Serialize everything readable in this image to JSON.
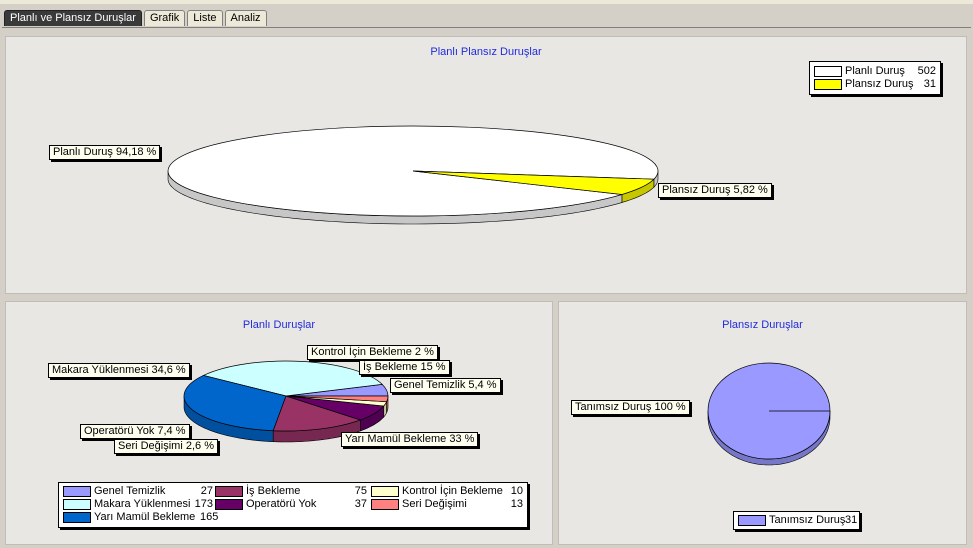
{
  "tabs": [
    {
      "label": "Planlı ve Plansız Duruşlar",
      "active": true
    },
    {
      "label": "Grafik",
      "active": false
    },
    {
      "label": "Liste",
      "active": false
    },
    {
      "label": "Analiz",
      "active": false
    }
  ],
  "chart_data": [
    {
      "type": "pie",
      "title": "Planlı Plansız Duruşlar",
      "slices": [
        {
          "name": "Planlı Duruş",
          "value": 502,
          "label": "Planlı Duruş 94,18 %",
          "color": "#ffffff"
        },
        {
          "name": "Plansız Duruş",
          "value": 31,
          "label": "Plansız Duruş 5,82 %",
          "color": "#ffff00"
        }
      ]
    },
    {
      "type": "pie",
      "title": "Planlı Duruşlar",
      "slices": [
        {
          "name": "Genel Temizlik",
          "value": 27,
          "label": "Genel Temizlik 5,4 %",
          "color": "#9999ff"
        },
        {
          "name": "Makara Yüklenmesi",
          "value": 173,
          "label": "Makara Yüklenmesi 34,6 %",
          "color": "#ccffff"
        },
        {
          "name": "Yarı Mamül Bekleme",
          "value": 165,
          "label": "Yarı Mamül Bekleme 33 %",
          "color": "#0066cc"
        },
        {
          "name": "İş Bekleme",
          "value": 75,
          "label": "İş Bekleme 15 %",
          "color": "#993366"
        },
        {
          "name": "Operatörü Yok",
          "value": 37,
          "label": "Operatörü Yok 7,4 %",
          "color": "#660066"
        },
        {
          "name": "Kontrol İçin Bekleme",
          "value": 10,
          "label": "Kontrol İçin Bekleme 2 %",
          "color": "#ffffcc"
        },
        {
          "name": "Seri Değişimi",
          "value": 13,
          "label": "Seri Değişimi 2,6 %",
          "color": "#ff8080"
        }
      ]
    },
    {
      "type": "pie",
      "title": "Plansız Duruşlar",
      "slices": [
        {
          "name": "Tanımsız Duruş",
          "value": 31,
          "label": "Tanımsız Duruş 100 %",
          "color": "#9999ff"
        }
      ]
    }
  ]
}
